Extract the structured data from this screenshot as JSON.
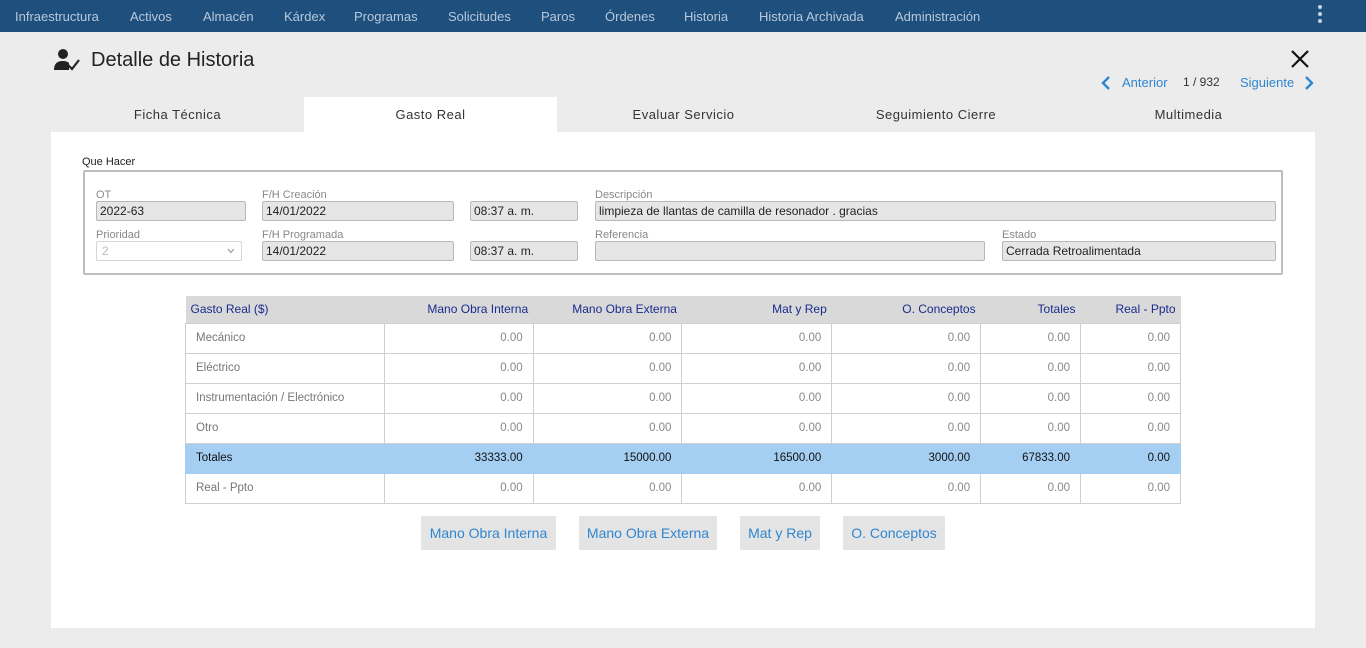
{
  "nav": {
    "items": [
      "Infraestructura",
      "Activos",
      "Almacén",
      "Kárdex",
      "Programas",
      "Solicitudes",
      "Paros",
      "Órdenes",
      "Historia",
      "Historia Archivada",
      "Administración"
    ]
  },
  "header": {
    "title": "Detalle de Historia",
    "prev_label": "Anterior",
    "count": "1 / 932",
    "next_label": "Siguiente"
  },
  "tabs": [
    "Ficha Técnica",
    "Gasto Real",
    "Evaluar Servicio",
    "Seguimiento Cierre",
    "Multimedia"
  ],
  "active_tab": "Gasto Real",
  "form": {
    "section_label": "Que Hacer",
    "ot": {
      "label": "OT",
      "value": "2022-63"
    },
    "fh_creacion": {
      "label": "F/H Creación",
      "date": "14/01/2022",
      "time": "08:37 a. m."
    },
    "descripcion": {
      "label": "Descripción",
      "value": "limpieza de llantas de camilla de resonador . gracias"
    },
    "prioridad": {
      "label": "Prioridad",
      "value": "2"
    },
    "fh_programada": {
      "label": "F/H Programada",
      "date": "14/01/2022",
      "time": "08:37 a. m."
    },
    "referencia": {
      "label": "Referencia",
      "value": ""
    },
    "estado": {
      "label": "Estado",
      "value": "Cerrada Retroalimentada"
    }
  },
  "table": {
    "headers": [
      "Gasto Real ($)",
      "Mano Obra Interna",
      "Mano Obra Externa",
      "Mat y Rep",
      "O. Conceptos",
      "Totales",
      "Real - Ppto"
    ],
    "rows": [
      [
        "Mecánico",
        "0.00",
        "0.00",
        "0.00",
        "0.00",
        "0.00",
        "0.00"
      ],
      [
        "Eléctrico",
        "0.00",
        "0.00",
        "0.00",
        "0.00",
        "0.00",
        "0.00"
      ],
      [
        "Instrumentación / Electrónico",
        "0.00",
        "0.00",
        "0.00",
        "0.00",
        "0.00",
        "0.00"
      ],
      [
        "Otro",
        "0.00",
        "0.00",
        "0.00",
        "0.00",
        "0.00",
        "0.00"
      ],
      [
        "Totales",
        "33333.00",
        "15000.00",
        "16500.00",
        "3000.00",
        "67833.00",
        "0.00"
      ],
      [
        "Real - Ppto",
        "0.00",
        "0.00",
        "0.00",
        "0.00",
        "0.00",
        "0.00"
      ]
    ]
  },
  "buttons": [
    "Mano Obra Interna",
    "Mano Obra Externa",
    "Mat y Rep",
    "O. Conceptos"
  ],
  "colors": {
    "nav_bg": "#1f4f7d",
    "accent": "#2f86d1",
    "totals_row": "#a4cff3",
    "header_text": "#1a2b8c"
  }
}
